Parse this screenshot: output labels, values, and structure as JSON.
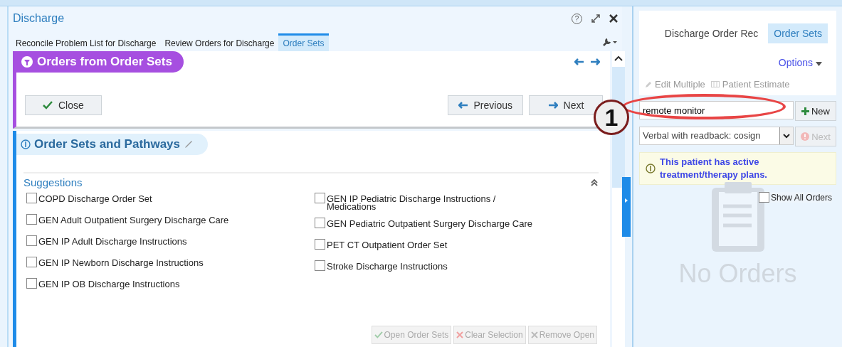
{
  "window": {
    "title": "Discharge",
    "help_glyph": "?"
  },
  "tabs": [
    {
      "label": "Reconcile Problem List for Discharge",
      "selected": false
    },
    {
      "label": "Review Orders for Discharge",
      "selected": false
    },
    {
      "label": "Order Sets",
      "selected": true
    }
  ],
  "orders_panel": {
    "title": "Orders from Order Sets",
    "buttons": [
      {
        "label": "Close",
        "kind": "check"
      },
      {
        "label": "Previous",
        "kind": "left"
      },
      {
        "label": "Next",
        "kind": "right"
      }
    ]
  },
  "order_sets_section": {
    "title": "Order Sets and Pathways",
    "group_label": "Suggestions",
    "suggestions": [
      [
        {
          "label": "COPD Discharge Order Set",
          "checked": false
        },
        {
          "label": "GEN Adult Outpatient Surgery Discharge Care",
          "checked": false
        },
        {
          "label": "GEN IP Adult Discharge Instructions",
          "checked": false
        },
        {
          "label": "GEN IP Newborn Discharge Instructions",
          "checked": false
        },
        {
          "label": "GEN IP OB Discharge Instructions",
          "checked": false
        }
      ],
      [
        {
          "label": "GEN IP Pediatric Discharge Instructions / Medications",
          "checked": false
        },
        {
          "label": "GEN Pediatric Outpatient Surgery Discharge Care",
          "checked": false
        },
        {
          "label": "PET CT Outpatient Order Set",
          "checked": false
        },
        {
          "label": "Stroke Discharge Instructions",
          "checked": false
        }
      ]
    ],
    "actions": [
      {
        "label": "Open Order Sets",
        "kind": "check",
        "disabled": true
      },
      {
        "label": "Clear Selection",
        "kind": "cross",
        "disabled": true
      },
      {
        "label": "Remove Open",
        "kind": "x",
        "disabled": true
      }
    ]
  },
  "sidebar": {
    "tabs": [
      {
        "label": "Discharge Order Rec",
        "selected": false
      },
      {
        "label": "Order Sets",
        "selected": true
      }
    ],
    "options_label": "Options",
    "tools": [
      {
        "label": "Edit Multiple",
        "kind": "pencil",
        "disabled": true
      },
      {
        "label": "Patient Estimate",
        "kind": "grid",
        "disabled": true
      }
    ],
    "search": {
      "value": "remote monitor"
    },
    "new_button": {
      "label": "New",
      "disabled": false
    },
    "mode_select": {
      "value": "Verbal with readback: cosign"
    },
    "next_button": {
      "label": "Next",
      "disabled": true
    },
    "notice": "This patient has active treatment/therapy plans.",
    "show_all_orders": {
      "label": "Show All Orders",
      "checked": false
    },
    "empty_message": "No Orders"
  },
  "callout": {
    "number": "1"
  }
}
